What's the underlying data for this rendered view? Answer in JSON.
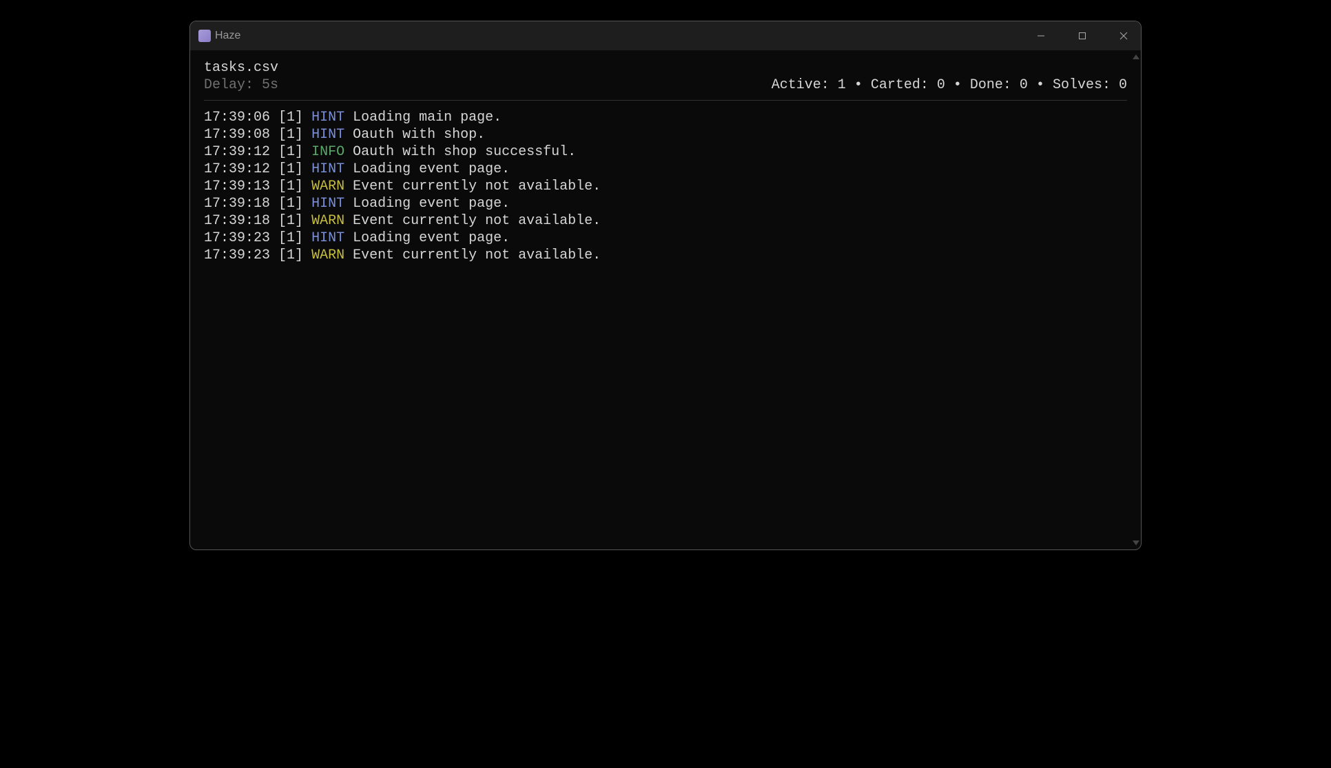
{
  "window": {
    "title": "Haze"
  },
  "header": {
    "filename": "tasks.csv",
    "delay_label": "Delay: 5s"
  },
  "stats": {
    "active_label": "Active:",
    "active_value": "1",
    "carted_label": "Carted:",
    "carted_value": "0",
    "done_label": "Done:",
    "done_value": "0",
    "solves_label": "Solves:",
    "solves_value": "0",
    "separator": " • "
  },
  "log_levels": {
    "hint": "HINT",
    "info": "INFO",
    "warn": "WARN"
  },
  "logs": [
    {
      "time": "17:39:06",
      "task": "[1]",
      "level": "HINT",
      "msg": "Loading main page."
    },
    {
      "time": "17:39:08",
      "task": "[1]",
      "level": "HINT",
      "msg": "Oauth with shop."
    },
    {
      "time": "17:39:12",
      "task": "[1]",
      "level": "INFO",
      "msg": "Oauth with shop successful."
    },
    {
      "time": "17:39:12",
      "task": "[1]",
      "level": "HINT",
      "msg": "Loading event page."
    },
    {
      "time": "17:39:13",
      "task": "[1]",
      "level": "WARN",
      "msg": "Event currently not available."
    },
    {
      "time": "17:39:18",
      "task": "[1]",
      "level": "HINT",
      "msg": "Loading event page."
    },
    {
      "time": "17:39:18",
      "task": "[1]",
      "level": "WARN",
      "msg": "Event currently not available."
    },
    {
      "time": "17:39:23",
      "task": "[1]",
      "level": "HINT",
      "msg": "Loading event page."
    },
    {
      "time": "17:39:23",
      "task": "[1]",
      "level": "WARN",
      "msg": "Event currently not available."
    }
  ]
}
